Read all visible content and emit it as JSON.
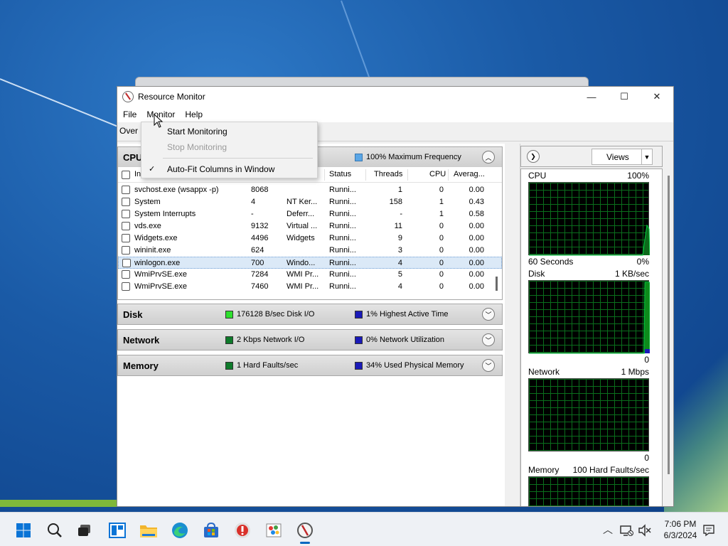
{
  "window": {
    "title": "Resource Monitor",
    "controls": {
      "minimize": "—",
      "maximize": "☐",
      "close": "✕"
    }
  },
  "menu": {
    "items": [
      "File",
      "Monitor",
      "Help"
    ],
    "dropdown": {
      "start": "Start Monitoring",
      "stop": "Stop Monitoring",
      "autofit": "Auto-Fit Columns in Window",
      "check": "✓"
    }
  },
  "tab": {
    "label": "Over"
  },
  "cpu": {
    "title": "CPU",
    "stat": "100% Maximum Frequency",
    "stat_color": "#5aa6e6",
    "columns": {
      "image": "In",
      "status": "Status",
      "threads": "Threads",
      "cpu": "CPU",
      "average": "Averag..."
    },
    "rows": [
      {
        "image": "svchost.exe (wsappx -p)",
        "pid": "8068",
        "desc": "",
        "status": "Runni...",
        "threads": "1",
        "cpu": "0",
        "avg": "0.00"
      },
      {
        "image": "System",
        "pid": "4",
        "desc": "NT Ker...",
        "status": "Runni...",
        "threads": "158",
        "cpu": "1",
        "avg": "0.43"
      },
      {
        "image": "System Interrupts",
        "pid": "-",
        "desc": "Deferr...",
        "status": "Runni...",
        "threads": "-",
        "cpu": "1",
        "avg": "0.58"
      },
      {
        "image": "vds.exe",
        "pid": "9132",
        "desc": "Virtual ...",
        "status": "Runni...",
        "threads": "11",
        "cpu": "0",
        "avg": "0.00"
      },
      {
        "image": "Widgets.exe",
        "pid": "4496",
        "desc": "Widgets",
        "status": "Runni...",
        "threads": "9",
        "cpu": "0",
        "avg": "0.00"
      },
      {
        "image": "wininit.exe",
        "pid": "624",
        "desc": "",
        "status": "Runni...",
        "threads": "3",
        "cpu": "0",
        "avg": "0.00"
      },
      {
        "image": "winlogon.exe",
        "pid": "700",
        "desc": "Windo...",
        "status": "Runni...",
        "threads": "4",
        "cpu": "0",
        "avg": "0.00"
      },
      {
        "image": "WmiPrvSE.exe",
        "pid": "7284",
        "desc": "WMI Pr...",
        "status": "Runni...",
        "threads": "5",
        "cpu": "0",
        "avg": "0.00"
      },
      {
        "image": "WmiPrvSE.exe",
        "pid": "7460",
        "desc": "WMI Pr...",
        "status": "Runni...",
        "threads": "4",
        "cpu": "0",
        "avg": "0.00"
      }
    ]
  },
  "disk": {
    "title": "Disk",
    "stat1": "176128 B/sec Disk I/O",
    "stat1_color": "#2ee02e",
    "stat2": "1% Highest Active Time",
    "stat2_color": "#1a1ab8"
  },
  "network": {
    "title": "Network",
    "stat1": "2 Kbps Network I/O",
    "stat1_color": "#0e7a2a",
    "stat2": "0% Network Utilization",
    "stat2_color": "#1a1ab8"
  },
  "memory": {
    "title": "Memory",
    "stat1": "1 Hard Faults/sec",
    "stat1_color": "#0e7a2a",
    "stat2": "34% Used Physical Memory",
    "stat2_color": "#1a1ab8"
  },
  "side": {
    "views": "Views",
    "cpu": {
      "label": "CPU",
      "max": "100%",
      "bottom_left": "60 Seconds",
      "bottom_right": "0%"
    },
    "disk": {
      "label": "Disk",
      "max": "1 KB/sec",
      "bottom_right": "0"
    },
    "network": {
      "label": "Network",
      "max": "1 Mbps",
      "bottom_right": "0"
    },
    "memory": {
      "label": "Memory",
      "max": "100 Hard Faults/sec"
    }
  },
  "taskbar": {
    "time": "7:06 PM",
    "date": "6/3/2024"
  },
  "colors": {
    "accent": "#0067c0",
    "graph_line": "#00d040"
  }
}
